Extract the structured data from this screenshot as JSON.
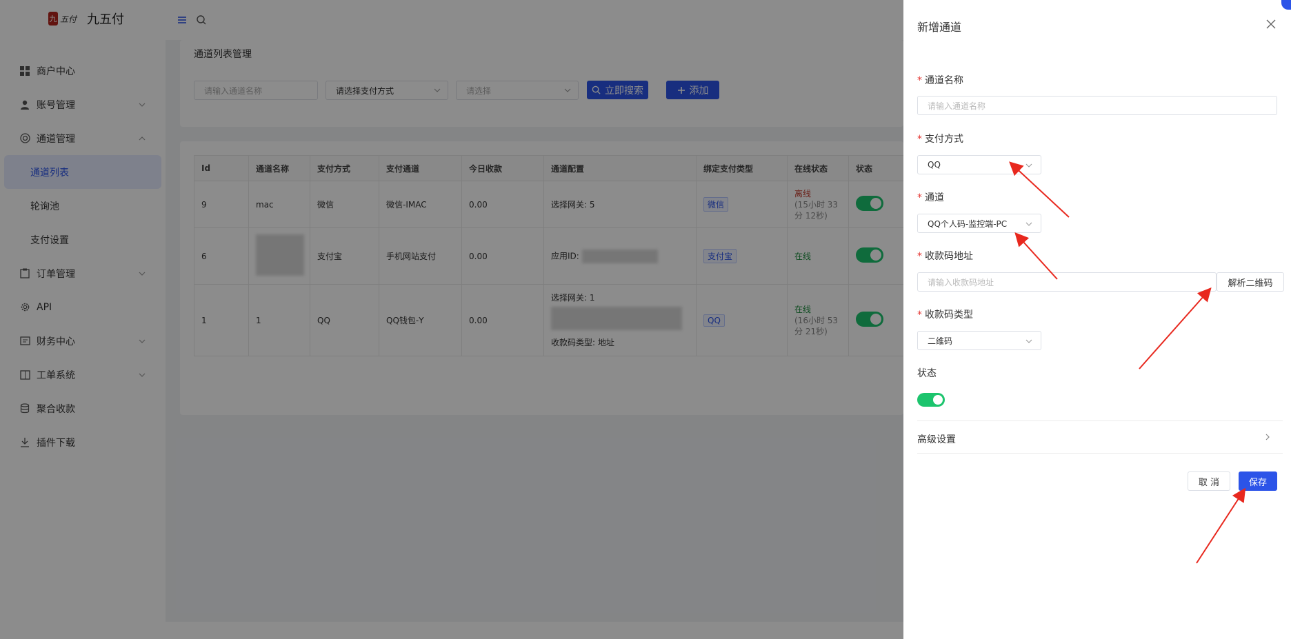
{
  "brand": {
    "name": "九五付",
    "seal_char": "九",
    "script_text": "五付"
  },
  "sidebar": {
    "items": [
      {
        "label": "商户中心",
        "icon": "grid-icon"
      },
      {
        "label": "账号管理",
        "icon": "user-icon"
      },
      {
        "label": "通道管理",
        "icon": "channel-icon"
      },
      {
        "label": "通道列表"
      },
      {
        "label": "轮询池"
      },
      {
        "label": "支付设置"
      },
      {
        "label": "订单管理",
        "icon": "clipboard-icon"
      },
      {
        "label": "API",
        "icon": "gear-icon"
      },
      {
        "label": "财务中心",
        "icon": "finance-icon"
      },
      {
        "label": "工单系统",
        "icon": "book-icon"
      },
      {
        "label": "聚合收款",
        "icon": "database-icon"
      },
      {
        "label": "插件下载",
        "icon": "download-icon"
      }
    ]
  },
  "page": {
    "title": "通道列表管理",
    "filters": {
      "name_placeholder": "请输入通道名称",
      "pay_method": "请选择支付方式",
      "other_placeholder": "请选择",
      "search_label": "立即搜索",
      "add_label": "添加"
    }
  },
  "table": {
    "headers": [
      "Id",
      "通道名称",
      "支付方式",
      "支付通道",
      "今日收款",
      "通道配置",
      "绑定支付类型",
      "在线状态",
      "状态"
    ],
    "rows": [
      {
        "id": "9",
        "name": "mac",
        "method": "微信",
        "channel": "微信-IMAC",
        "today": "0.00",
        "config1": "选择网关: 5",
        "config2": "",
        "bind": "微信",
        "status_main": "离线",
        "status_sub": "(15小时 33 分 12秒)"
      },
      {
        "id": "6",
        "name": "",
        "method": "支付宝",
        "channel": "手机网站支付",
        "today": "0.00",
        "config1": "应用ID:",
        "config2": "",
        "bind": "支付宝",
        "status_main": "在线",
        "status_sub": ""
      },
      {
        "id": "1",
        "name": "1",
        "method": "QQ",
        "channel": "QQ钱包-Y",
        "today": "0.00",
        "config1": "选择网关: 1",
        "config2": "收款码类型: 地址",
        "bind": "QQ",
        "status_main": "在线",
        "status_sub": "(16小时 53 分 21秒)"
      }
    ]
  },
  "drawer": {
    "title": "新增通道",
    "fields": {
      "name_label": "通道名称",
      "name_placeholder": "请输入通道名称",
      "method_label": "支付方式",
      "method_value": "QQ",
      "channel_label": "通道",
      "channel_value": "QQ个人码-监控端-PC",
      "qr_url_label": "收款码地址",
      "qr_url_placeholder": "请输入收款码地址",
      "parse_label": "解析二维码",
      "qr_type_label": "收款码类型",
      "qr_type_value": "二维码",
      "status_label": "状态",
      "status_on": true
    },
    "advanced_label": "高级设置",
    "cancel_label": "取 消",
    "save_label": "保存"
  },
  "colors": {
    "primary": "#2c54e8",
    "success": "#1cc46d",
    "danger": "#e53935",
    "annotation": "#e8281e"
  }
}
